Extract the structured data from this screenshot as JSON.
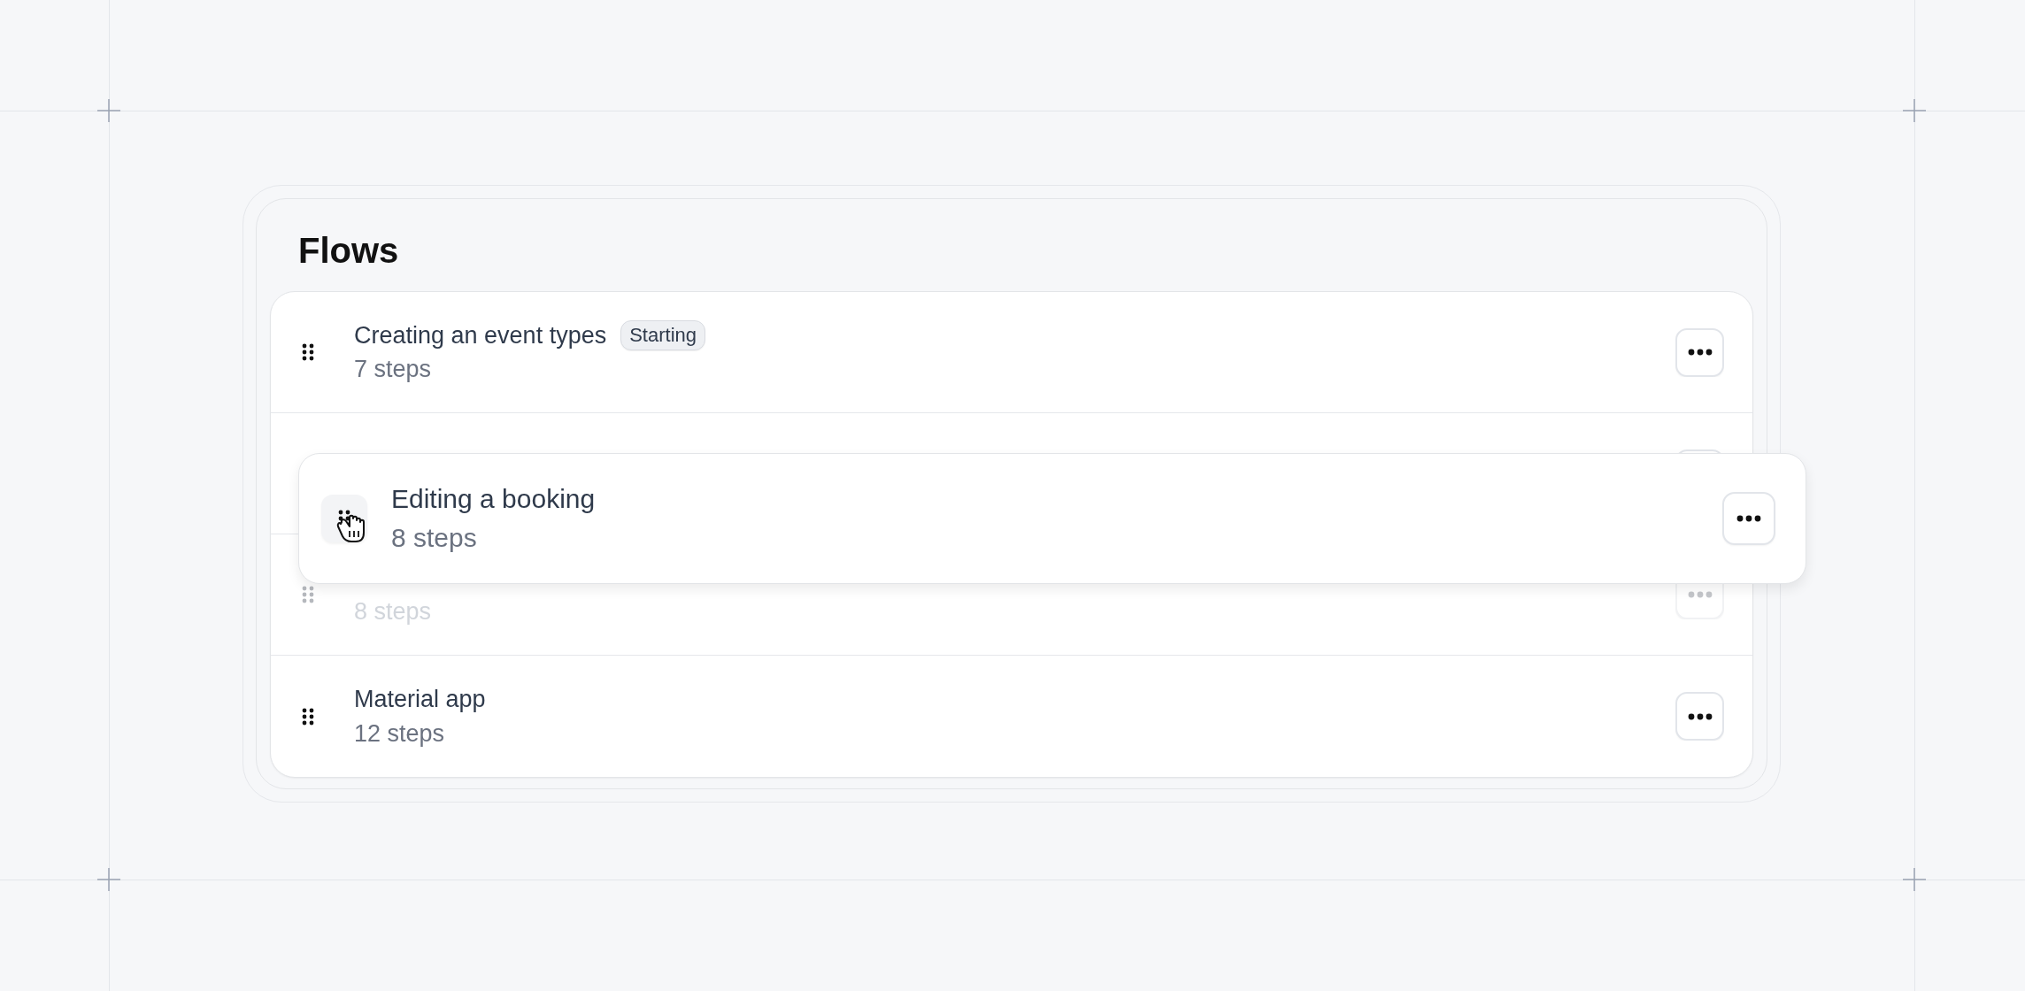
{
  "title": "Flows",
  "flows": [
    {
      "title": "Creating an event types",
      "badge": "Starting",
      "steps": "7 steps",
      "faded": false
    },
    {
      "faded": false
    },
    {
      "steps": "8 steps",
      "faded": true
    },
    {
      "title": "Material app",
      "steps": "12 steps",
      "faded": false
    }
  ],
  "dragged": {
    "title": "Editing a booking",
    "steps": "8 steps"
  }
}
